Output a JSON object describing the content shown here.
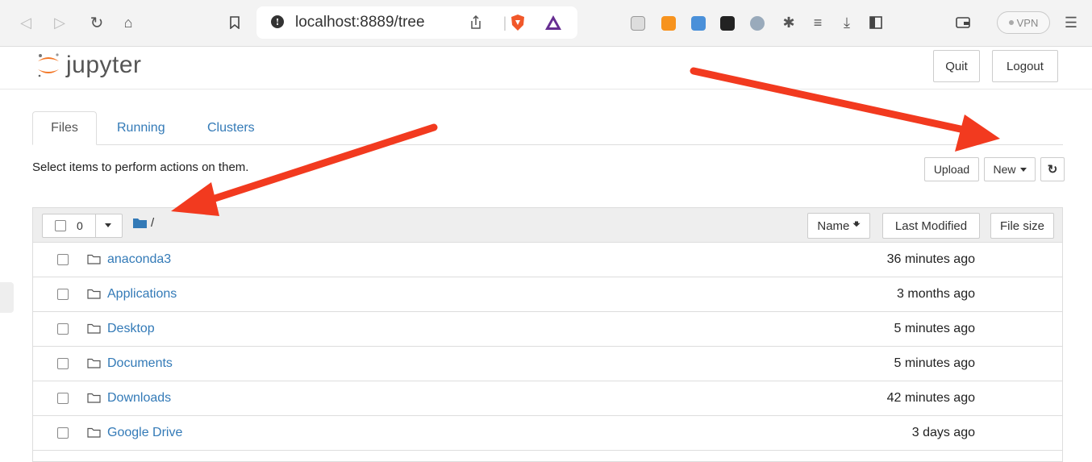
{
  "browser": {
    "url": "localhost:8889/tree",
    "vpn_label": "VPN"
  },
  "header": {
    "logo_text": "jupyter",
    "quit_label": "Quit",
    "logout_label": "Logout"
  },
  "tabs": [
    {
      "label": "Files",
      "active": true
    },
    {
      "label": "Running",
      "active": false
    },
    {
      "label": "Clusters",
      "active": false
    }
  ],
  "toolbar": {
    "select_message": "Select items to perform actions on them.",
    "upload_label": "Upload",
    "new_label": "New"
  },
  "list": {
    "selected_count": "0",
    "breadcrumb": "/",
    "columns": {
      "name": "Name",
      "last_modified": "Last Modified",
      "file_size": "File size"
    },
    "rows": [
      {
        "name": "anaconda3",
        "modified": "36 minutes ago"
      },
      {
        "name": "Applications",
        "modified": "3 months ago"
      },
      {
        "name": "Desktop",
        "modified": "5 minutes ago"
      },
      {
        "name": "Documents",
        "modified": "5 minutes ago"
      },
      {
        "name": "Downloads",
        "modified": "42 minutes ago"
      },
      {
        "name": "Google Drive",
        "modified": "3 days ago"
      }
    ]
  },
  "colors": {
    "link": "#337ab7",
    "arrow": "#f23a1f",
    "jupyter_orange": "#f37726"
  }
}
